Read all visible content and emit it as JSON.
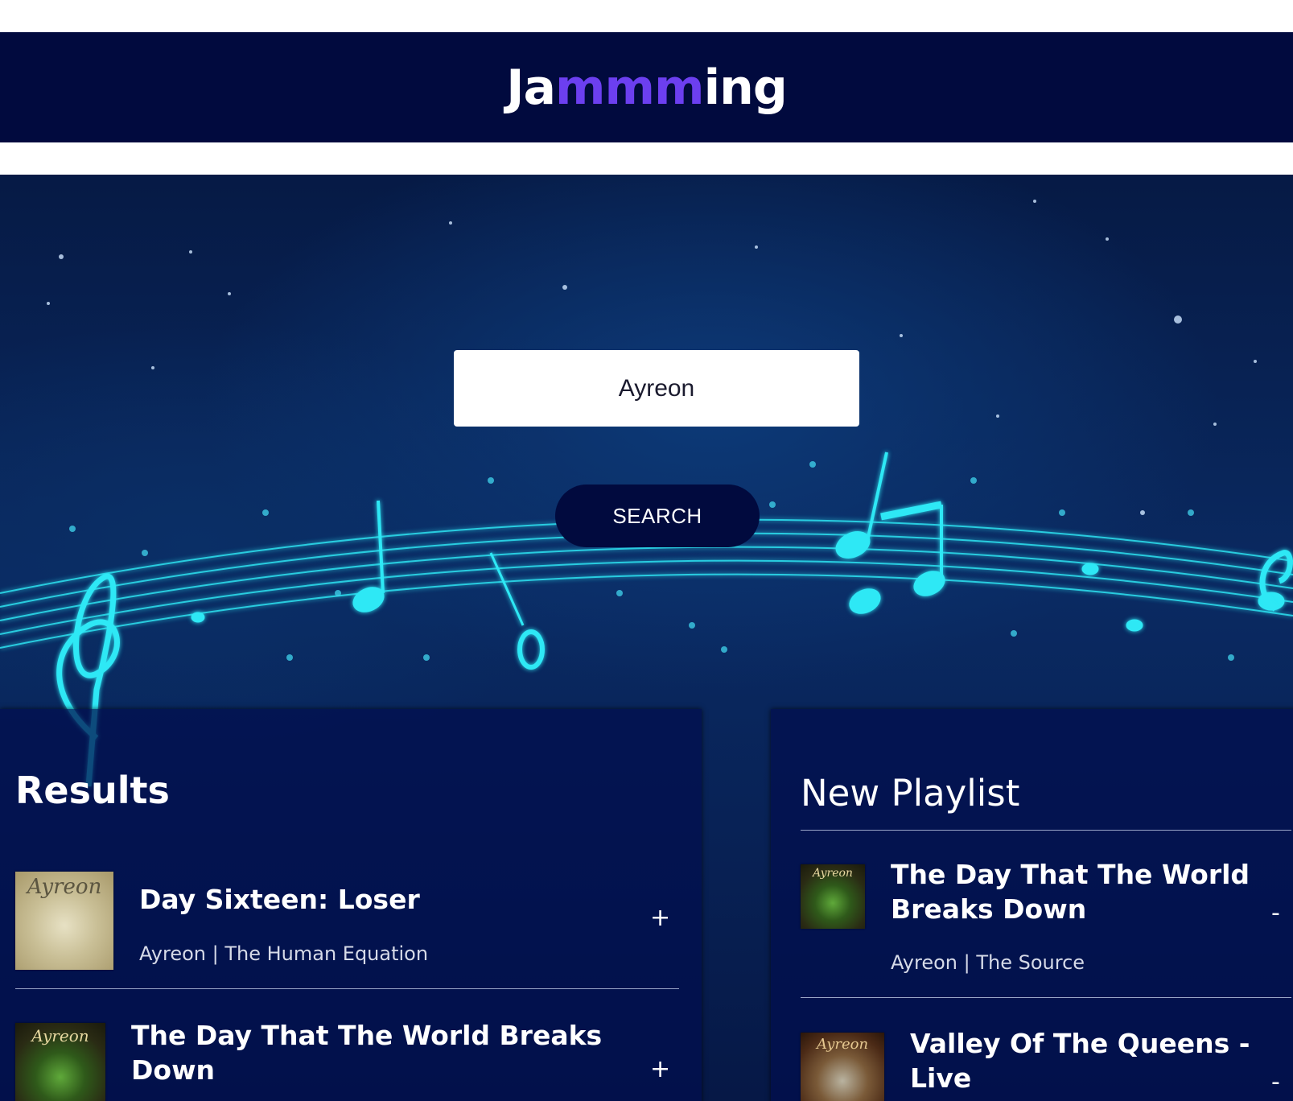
{
  "header": {
    "logo_part1": "Ja",
    "logo_accent": "mmm",
    "logo_part2": "ing"
  },
  "search": {
    "value": "Ayreon",
    "button_label": "SEARCH"
  },
  "results": {
    "title": "Results",
    "tracks": [
      {
        "name": "Day Sixteen: Loser",
        "meta": "Ayreon | The Human Equation",
        "cover_text": "Ayreon",
        "action": "+"
      },
      {
        "name": "The Day That The World Breaks Down",
        "meta": "",
        "cover_text": "Ayreon",
        "action": "+"
      }
    ]
  },
  "playlist": {
    "title": "New Playlist",
    "tracks": [
      {
        "name": "The Day That The World Breaks Down",
        "meta": "Ayreon | The Source",
        "cover_text": "Ayreon",
        "action": "-"
      },
      {
        "name": "Valley Of The Queens - Live",
        "meta": "",
        "cover_text": "Ayreon",
        "action": "-"
      }
    ]
  },
  "colors": {
    "header_bg": "#010a3e",
    "logo_accent": "#6c3ff0",
    "note_glow": "#2ee8f5"
  }
}
